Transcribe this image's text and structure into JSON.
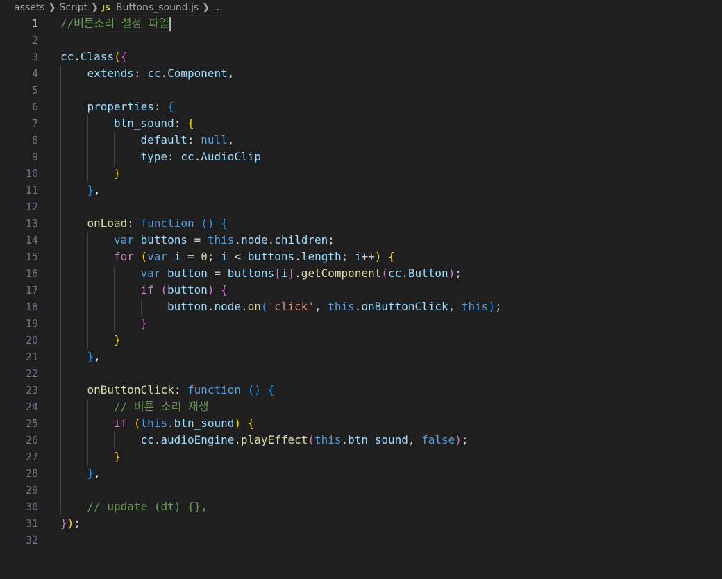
{
  "breadcrumb": {
    "items": [
      "assets",
      "Script",
      "Buttons_sound.js",
      "..."
    ],
    "file_badge": "JS",
    "separator": ">"
  },
  "editor": {
    "current_line": 1,
    "language": "javascript",
    "colors": {
      "background": "#1f1f1f",
      "line_number": "#6e7681",
      "active_line_number": "#cccccc",
      "comment": "#6a9955",
      "keyword": "#569cd6",
      "variable": "#9cdcfe",
      "function": "#dcdcaa",
      "control": "#c586c0",
      "string": "#ce9178",
      "number": "#b5cea8",
      "type": "#4ec9b0",
      "bracket_1": "#ffd700",
      "bracket_2": "#da70d6",
      "bracket_3": "#179fff"
    },
    "lines": [
      {
        "n": "1",
        "indent": 0,
        "tokens": [
          [
            "//버튼소리 설정 파일",
            "c"
          ]
        ]
      },
      {
        "n": "2",
        "indent": 0,
        "tokens": []
      },
      {
        "n": "3",
        "indent": 0,
        "tokens": [
          [
            "cc",
            "v"
          ],
          [
            ".",
            "o"
          ],
          [
            "Class",
            "v"
          ],
          [
            "(",
            "b1"
          ],
          [
            "{",
            "b2"
          ]
        ]
      },
      {
        "n": "4",
        "indent": 1,
        "tokens": [
          [
            "extends",
            "v"
          ],
          [
            ": ",
            "o"
          ],
          [
            "cc",
            "v"
          ],
          [
            ".",
            "o"
          ],
          [
            "Component",
            "v"
          ],
          [
            ",",
            "o"
          ]
        ]
      },
      {
        "n": "5",
        "indent": 1,
        "tokens": []
      },
      {
        "n": "6",
        "indent": 1,
        "tokens": [
          [
            "properties",
            "v"
          ],
          [
            ": ",
            "o"
          ],
          [
            "{",
            "b3"
          ]
        ]
      },
      {
        "n": "7",
        "indent": 2,
        "tokens": [
          [
            "btn_sound",
            "v"
          ],
          [
            ": ",
            "o"
          ],
          [
            "{",
            "b1"
          ]
        ]
      },
      {
        "n": "8",
        "indent": 3,
        "tokens": [
          [
            "default",
            "v"
          ],
          [
            ": ",
            "o"
          ],
          [
            "null",
            "k"
          ],
          [
            ",",
            "o"
          ]
        ]
      },
      {
        "n": "9",
        "indent": 3,
        "tokens": [
          [
            "type",
            "v"
          ],
          [
            ": ",
            "o"
          ],
          [
            "cc",
            "v"
          ],
          [
            ".",
            "o"
          ],
          [
            "AudioClip",
            "v"
          ]
        ]
      },
      {
        "n": "10",
        "indent": 2,
        "tokens": [
          [
            "}",
            "b1"
          ]
        ]
      },
      {
        "n": "11",
        "indent": 1,
        "tokens": [
          [
            "}",
            "b3"
          ],
          [
            ",",
            "o"
          ]
        ]
      },
      {
        "n": "12",
        "indent": 1,
        "tokens": []
      },
      {
        "n": "13",
        "indent": 1,
        "tokens": [
          [
            "onLoad",
            "f"
          ],
          [
            ": ",
            "o"
          ],
          [
            "function",
            "k"
          ],
          [
            " ",
            "o"
          ],
          [
            "()",
            "b3"
          ],
          [
            " ",
            "o"
          ],
          [
            "{",
            "b3"
          ]
        ]
      },
      {
        "n": "14",
        "indent": 2,
        "tokens": [
          [
            "var",
            "k"
          ],
          [
            " ",
            "o"
          ],
          [
            "buttons",
            "v"
          ],
          [
            " = ",
            "o"
          ],
          [
            "this",
            "k"
          ],
          [
            ".",
            "o"
          ],
          [
            "node",
            "v"
          ],
          [
            ".",
            "o"
          ],
          [
            "children",
            "v"
          ],
          [
            ";",
            "o"
          ]
        ]
      },
      {
        "n": "15",
        "indent": 2,
        "tokens": [
          [
            "for",
            "p"
          ],
          [
            " ",
            "o"
          ],
          [
            "(",
            "b1"
          ],
          [
            "var",
            "k"
          ],
          [
            " ",
            "o"
          ],
          [
            "i",
            "v"
          ],
          [
            " = ",
            "o"
          ],
          [
            "0",
            "n"
          ],
          [
            "; ",
            "o"
          ],
          [
            "i",
            "v"
          ],
          [
            " < ",
            "o"
          ],
          [
            "buttons",
            "v"
          ],
          [
            ".",
            "o"
          ],
          [
            "length",
            "v"
          ],
          [
            "; ",
            "o"
          ],
          [
            "i",
            "v"
          ],
          [
            "++",
            "o"
          ],
          [
            ")",
            "b1"
          ],
          [
            " ",
            "o"
          ],
          [
            "{",
            "b1"
          ]
        ]
      },
      {
        "n": "16",
        "indent": 3,
        "tokens": [
          [
            "var",
            "k"
          ],
          [
            " ",
            "o"
          ],
          [
            "button",
            "v"
          ],
          [
            " = ",
            "o"
          ],
          [
            "buttons",
            "v"
          ],
          [
            "[",
            "b2"
          ],
          [
            "i",
            "v"
          ],
          [
            "]",
            "b2"
          ],
          [
            ".",
            "o"
          ],
          [
            "getComponent",
            "f"
          ],
          [
            "(",
            "b2"
          ],
          [
            "cc",
            "v"
          ],
          [
            ".",
            "o"
          ],
          [
            "Button",
            "v"
          ],
          [
            ")",
            "b2"
          ],
          [
            ";",
            "o"
          ]
        ]
      },
      {
        "n": "17",
        "indent": 3,
        "tokens": [
          [
            "if",
            "p"
          ],
          [
            " ",
            "o"
          ],
          [
            "(",
            "b2"
          ],
          [
            "button",
            "v"
          ],
          [
            ")",
            "b2"
          ],
          [
            " ",
            "o"
          ],
          [
            "{",
            "b2"
          ]
        ]
      },
      {
        "n": "18",
        "indent": 4,
        "tokens": [
          [
            "button",
            "v"
          ],
          [
            ".",
            "o"
          ],
          [
            "node",
            "v"
          ],
          [
            ".",
            "o"
          ],
          [
            "on",
            "f"
          ],
          [
            "(",
            "b3"
          ],
          [
            "'click'",
            "s"
          ],
          [
            ", ",
            "o"
          ],
          [
            "this",
            "k"
          ],
          [
            ".",
            "o"
          ],
          [
            "onButtonClick",
            "v"
          ],
          [
            ", ",
            "o"
          ],
          [
            "this",
            "k"
          ],
          [
            ")",
            "b3"
          ],
          [
            ";",
            "o"
          ]
        ]
      },
      {
        "n": "19",
        "indent": 3,
        "tokens": [
          [
            "}",
            "b2"
          ]
        ]
      },
      {
        "n": "20",
        "indent": 2,
        "tokens": [
          [
            "}",
            "b1"
          ]
        ]
      },
      {
        "n": "21",
        "indent": 1,
        "tokens": [
          [
            "}",
            "b3"
          ],
          [
            ",",
            "o"
          ]
        ]
      },
      {
        "n": "22",
        "indent": 1,
        "tokens": []
      },
      {
        "n": "23",
        "indent": 1,
        "tokens": [
          [
            "onButtonClick",
            "f"
          ],
          [
            ": ",
            "o"
          ],
          [
            "function",
            "k"
          ],
          [
            " ",
            "o"
          ],
          [
            "()",
            "b3"
          ],
          [
            " ",
            "o"
          ],
          [
            "{",
            "b3"
          ]
        ]
      },
      {
        "n": "24",
        "indent": 2,
        "tokens": [
          [
            "// 버튼 소리 재생",
            "c"
          ]
        ]
      },
      {
        "n": "25",
        "indent": 2,
        "tokens": [
          [
            "if",
            "p"
          ],
          [
            " ",
            "o"
          ],
          [
            "(",
            "b1"
          ],
          [
            "this",
            "k"
          ],
          [
            ".",
            "o"
          ],
          [
            "btn_sound",
            "v"
          ],
          [
            ")",
            "b1"
          ],
          [
            " ",
            "o"
          ],
          [
            "{",
            "b1"
          ]
        ]
      },
      {
        "n": "26",
        "indent": 3,
        "tokens": [
          [
            "cc",
            "v"
          ],
          [
            ".",
            "o"
          ],
          [
            "audioEngine",
            "v"
          ],
          [
            ".",
            "o"
          ],
          [
            "playEffect",
            "f"
          ],
          [
            "(",
            "b2"
          ],
          [
            "this",
            "k"
          ],
          [
            ".",
            "o"
          ],
          [
            "btn_sound",
            "v"
          ],
          [
            ", ",
            "o"
          ],
          [
            "false",
            "k"
          ],
          [
            ")",
            "b2"
          ],
          [
            ";",
            "o"
          ]
        ]
      },
      {
        "n": "27",
        "indent": 2,
        "tokens": [
          [
            "}",
            "b1"
          ]
        ]
      },
      {
        "n": "28",
        "indent": 1,
        "tokens": [
          [
            "}",
            "b3"
          ],
          [
            ",",
            "o"
          ]
        ]
      },
      {
        "n": "29",
        "indent": 1,
        "tokens": []
      },
      {
        "n": "30",
        "indent": 1,
        "tokens": [
          [
            "// update (dt) {},",
            "c"
          ]
        ]
      },
      {
        "n": "31",
        "indent": 0,
        "tokens": [
          [
            "}",
            "b2"
          ],
          [
            ")",
            "b1"
          ],
          [
            ";",
            "o"
          ]
        ]
      },
      {
        "n": "32",
        "indent": 0,
        "tokens": []
      }
    ]
  }
}
